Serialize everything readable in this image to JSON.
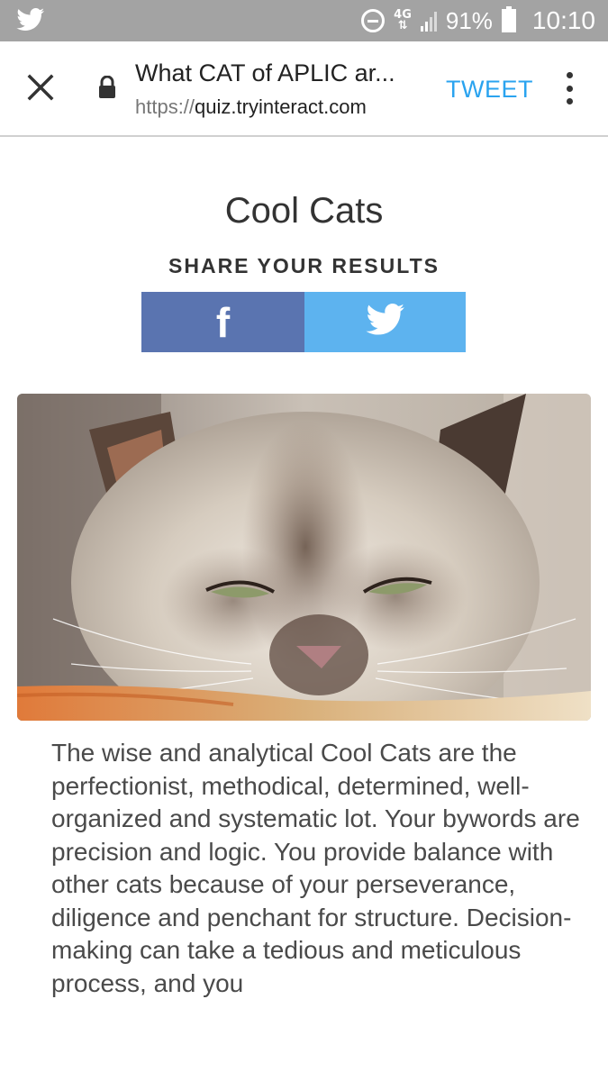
{
  "status_bar": {
    "network": "4G",
    "battery": "91%",
    "time": "10:10"
  },
  "browser": {
    "title": "What CAT of APLIC ar...",
    "url_scheme": "https://",
    "url_host": "quiz.tryinteract.com",
    "tweet_label": "TWEET"
  },
  "result": {
    "title": "Cool Cats",
    "share_heading": "SHARE YOUR RESULTS",
    "facebook_glyph": "f",
    "description": "The wise and analytical Cool Cats are the perfectionist, methodical, determined, well-organized and systematic lot. Your bywords are precision and logic. You provide balance with other cats because of your perseverance, diligence and penchant for structure. Decision-making can take a tedious and meticulous process, and you"
  },
  "colors": {
    "status_bar": "#a3a3a3",
    "tweet_accent": "#2aa3ef",
    "facebook": "#5a74b0",
    "twitter": "#5db3ef"
  },
  "icons": {
    "notification": "twitter-bird-icon",
    "close": "close-icon",
    "lock": "lock-icon",
    "menu": "more-vertical-icon",
    "share_twitter": "twitter-bird-icon",
    "share_facebook": "facebook-icon"
  }
}
